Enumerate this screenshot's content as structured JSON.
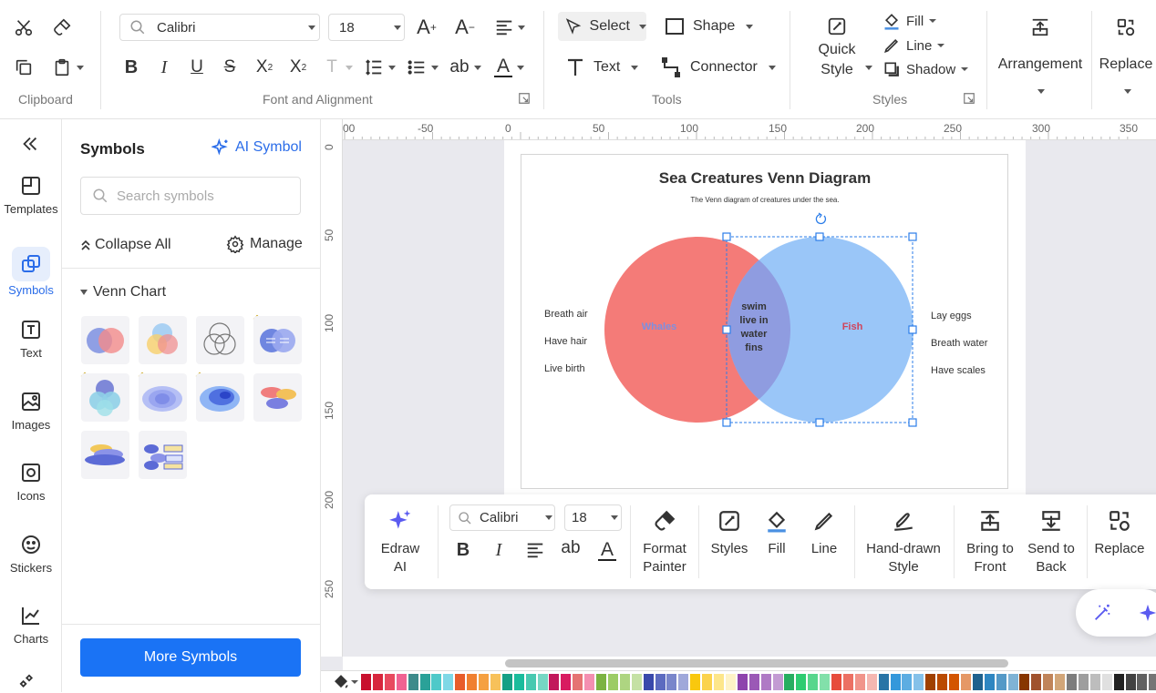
{
  "ribbon": {
    "font_name": "Calibri",
    "font_size": "18",
    "groups": {
      "clipboard": "Clipboard",
      "font_alignment": "Font and Alignment",
      "tools": "Tools",
      "styles": "Styles"
    },
    "tools": {
      "select": "Select",
      "shape": "Shape",
      "text": "Text",
      "connector": "Connector"
    },
    "styles": {
      "quick_style_line1": "Quick",
      "quick_style_line2": "Style",
      "fill": "Fill",
      "line": "Line",
      "shadow": "Shadow"
    },
    "arrangement": "Arrangement",
    "replace": "Replace"
  },
  "rail": [
    {
      "label": "Templates",
      "icon": "templates-icon"
    },
    {
      "label": "Symbols",
      "icon": "symbols-icon",
      "active": true
    },
    {
      "label": "Text",
      "icon": "text-icon"
    },
    {
      "label": "Images",
      "icon": "images-icon"
    },
    {
      "label": "Icons",
      "icon": "icons-icon"
    },
    {
      "label": "Stickers",
      "icon": "stickers-icon"
    },
    {
      "label": "Charts",
      "icon": "charts-icon"
    }
  ],
  "panel": {
    "title": "Symbols",
    "ai_symbol": "AI Symbol",
    "search_placeholder": "Search symbols",
    "collapse_all": "Collapse All",
    "manage": "Manage",
    "category": "Venn Chart",
    "more_symbols": "More Symbols"
  },
  "rulers": {
    "top": [
      "00",
      "-50",
      "0",
      "50",
      "100",
      "150",
      "200",
      "250",
      "300",
      "350"
    ],
    "left": [
      "0",
      "50",
      "100",
      "150",
      "200",
      "250"
    ]
  },
  "diagram": {
    "title": "Sea Creatures Venn Diagram",
    "subtitle": "The Venn diagram of creatures under the sea.",
    "left_label": "Whales",
    "right_label": "Fish",
    "overlap": [
      "swim",
      "live in",
      "water",
      "fins"
    ],
    "left_traits": [
      "Breath air",
      "Have hair",
      "Live birth"
    ],
    "right_traits": [
      "Lay eggs",
      "Breath water",
      "Have scales"
    ],
    "colors": {
      "left": "#f46f6c",
      "right": "#8fc1f7",
      "overlap": "#8f9ce0",
      "selection": "#2b7de9"
    }
  },
  "float_toolbar": {
    "edraw_ai": "Edraw AI",
    "font_name": "Calibri",
    "font_size": "18",
    "format_painter_line1": "Format",
    "format_painter_line2": "Painter",
    "styles": "Styles",
    "fill": "Fill",
    "line": "Line",
    "hand_drawn_line1": "Hand-drawn",
    "hand_drawn_line2": "Style",
    "bring_front_line1": "Bring to",
    "bring_front_line2": "Front",
    "send_back_line1": "Send to",
    "send_back_line2": "Back",
    "replace": "Replace"
  },
  "palette_colors": [
    "#c8102e",
    "#d7263d",
    "#e84a5f",
    "#f06292",
    "#3d8b8b",
    "#2aa198",
    "#4ec9c9",
    "#7fd8e6",
    "#e85d2a",
    "#f08030",
    "#f5a041",
    "#f7c15a",
    "#16a085",
    "#1abc9c",
    "#48c9b0",
    "#76d7c4",
    "#c2185b",
    "#d81b60",
    "#e57373",
    "#f48fb1",
    "#7cb342",
    "#9ccc65",
    "#aed581",
    "#c5e1a5",
    "#3949ab",
    "#5c6bc0",
    "#7986cb",
    "#9fa8da",
    "#f9c80e",
    "#fbd34d",
    "#fde68a",
    "#fef3c7",
    "#8e44ad",
    "#9b59b6",
    "#af7ac5",
    "#c39bd3",
    "#27ae60",
    "#2ecc71",
    "#58d68d",
    "#82e0aa",
    "#e74c3c",
    "#ec7063",
    "#f1948a",
    "#f5b7b1",
    "#2874a6",
    "#3498db",
    "#5dade2",
    "#85c1e9",
    "#a04000",
    "#ba4a00",
    "#d35400",
    "#e59866",
    "#1f618d",
    "#2e86c1",
    "#5499c7",
    "#7fb3d5",
    "#873600",
    "#a0522d",
    "#c0845a",
    "#d2a679",
    "#7d7d7d",
    "#9e9e9e",
    "#bdbdbd",
    "#e0e0e0",
    "#212121",
    "#424242",
    "#616161",
    "#757575"
  ]
}
